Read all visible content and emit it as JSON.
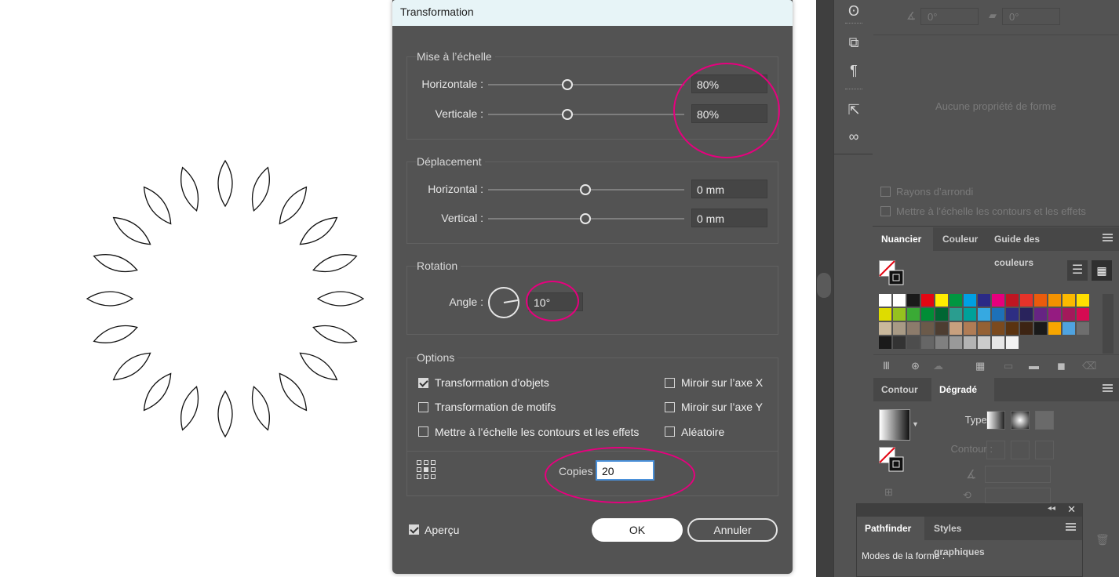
{
  "dialog": {
    "title": "Transformation",
    "scale": {
      "section_title": "Mise à l’échelle",
      "horizontal_label": "Horizontale :",
      "horizontal_value": "80%",
      "vertical_label": "Verticale :",
      "vertical_value": "80%"
    },
    "move": {
      "section_title": "Déplacement",
      "horizontal_label": "Horizontal :",
      "horizontal_value": "0 mm",
      "vertical_label": "Vertical :",
      "vertical_value": "0 mm"
    },
    "rotation": {
      "section_title": "Rotation",
      "angle_label": "Angle :",
      "angle_value": "10°"
    },
    "options": {
      "section_title": "Options",
      "transform_objects": "Transformation d’objets",
      "transform_patterns": "Transformation de motifs",
      "scale_strokes": "Mettre à l’échelle les contours et les effets",
      "mirror_x": "Miroir sur l’axe X",
      "mirror_y": "Miroir sur l’axe Y",
      "random": "Aléatoire"
    },
    "copies_label": "Copies",
    "copies_value": "20",
    "preview_label": "Aperçu",
    "ok_label": "OK",
    "cancel_label": "Annuler"
  },
  "properties": {
    "angle_a": "0°",
    "angle_b": "0°",
    "no_shape": "Aucune propriété de forme",
    "corner_radius": "Rayons d’arrondi",
    "scale_strokes": "Mettre à l’échelle les contours et les effets"
  },
  "swatches_panel": {
    "tabs": [
      "Nuancier",
      "Couleur",
      "Guide des couleurs"
    ],
    "colors": [
      [
        "#ffffff",
        "#ffffff",
        "#1a1a1a",
        "#e30613",
        "#ffed00",
        "#009640",
        "#00a0e3",
        "#2b2a86",
        "#e5007d",
        "#be1622",
        "#e6332a",
        "#ea5b0c",
        "#f39200",
        "#fbb900",
        "#ffdf00"
      ],
      [
        "#dedc00",
        "#95c11f",
        "#3aaa35",
        "#008d36",
        "#006633",
        "#2a9d8f",
        "#00a19a",
        "#36a9e1",
        "#1d71b8",
        "#2d2e83",
        "#29235c",
        "#662483",
        "#951b81",
        "#a3195b",
        "#d60b52"
      ],
      [
        "#c9b89c",
        "#a89a85",
        "#8c7b6b",
        "#6b5a4a",
        "#4d3d31",
        "#c8a07e",
        "#b07c55",
        "#956134",
        "#7b4a1e",
        "#5a3310",
        "#3d2413",
        "#1a1a1a",
        "#f7a600",
        "#4fa3e0",
        "#6e6e6e"
      ],
      [
        "#1a1a1a",
        "#333333",
        "#4d4d4d",
        "#666666",
        "#808080",
        "#999999",
        "#b3b3b3",
        "#cccccc",
        "#e6e6e6",
        "#f2f2f2"
      ]
    ]
  },
  "gradient_panel": {
    "tabs": [
      "Contour",
      "Dégradé"
    ],
    "type_label": "Type :",
    "stroke_label": "Contour :"
  },
  "pathfinder_panel": {
    "tabs": [
      "Pathfinder",
      "Styles graphiques"
    ],
    "shape_modes": "Modes de la forme :"
  }
}
